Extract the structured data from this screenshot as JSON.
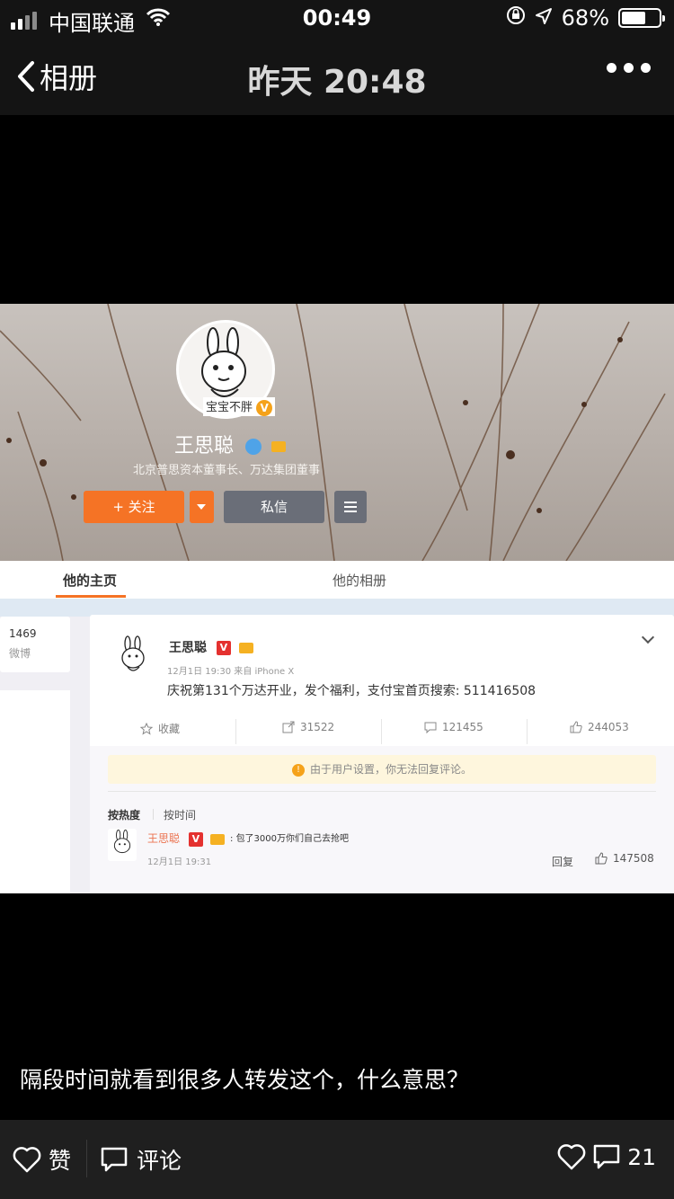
{
  "status_bar": {
    "carrier": "中国联通",
    "time": "00:49",
    "battery_text": "68%",
    "battery_level": 0.68
  },
  "nav": {
    "back_label": "相册",
    "title": "昨天 20:48"
  },
  "photo": {
    "profile": {
      "avatar_caption": "宝宝不胖",
      "name": "王思聪",
      "subtitle": "北京普思资本董事长、万达集团董事",
      "follow_label": "+ 关注",
      "message_label": "私信"
    },
    "tabs": [
      {
        "label": "他的主页",
        "active": true
      },
      {
        "label": "他的相册",
        "active": false
      }
    ],
    "left_stats": {
      "count": "1469",
      "label": "微博"
    },
    "post": {
      "author": "王思聪",
      "meta": "12月1日 19:30 来自 iPhone X",
      "text": "庆祝第131个万达开业，发个福利，支付宝首页搜索: 511416508",
      "actions": {
        "favorite": "收藏",
        "repost": "31522",
        "comment": "121455",
        "like": "244053"
      },
      "notice": "由于用户设置，你无法回复评论。",
      "sort_hot": "按热度",
      "sort_time": "按时间",
      "comment": {
        "author": "王思聪",
        "text": "包了3000万你们自己去抢吧",
        "time": "12月1日 19:31",
        "reply_label": "回复",
        "likes": "147508"
      }
    }
  },
  "caption": "隔段时间就看到很多人转发这个，什么意思？",
  "bottom_bar": {
    "like_label": "赞",
    "comment_label": "评论",
    "count": "21"
  },
  "colors": {
    "accent_orange": "#f57325",
    "verified": "#f5a21a",
    "vip_red": "#e4312f"
  }
}
